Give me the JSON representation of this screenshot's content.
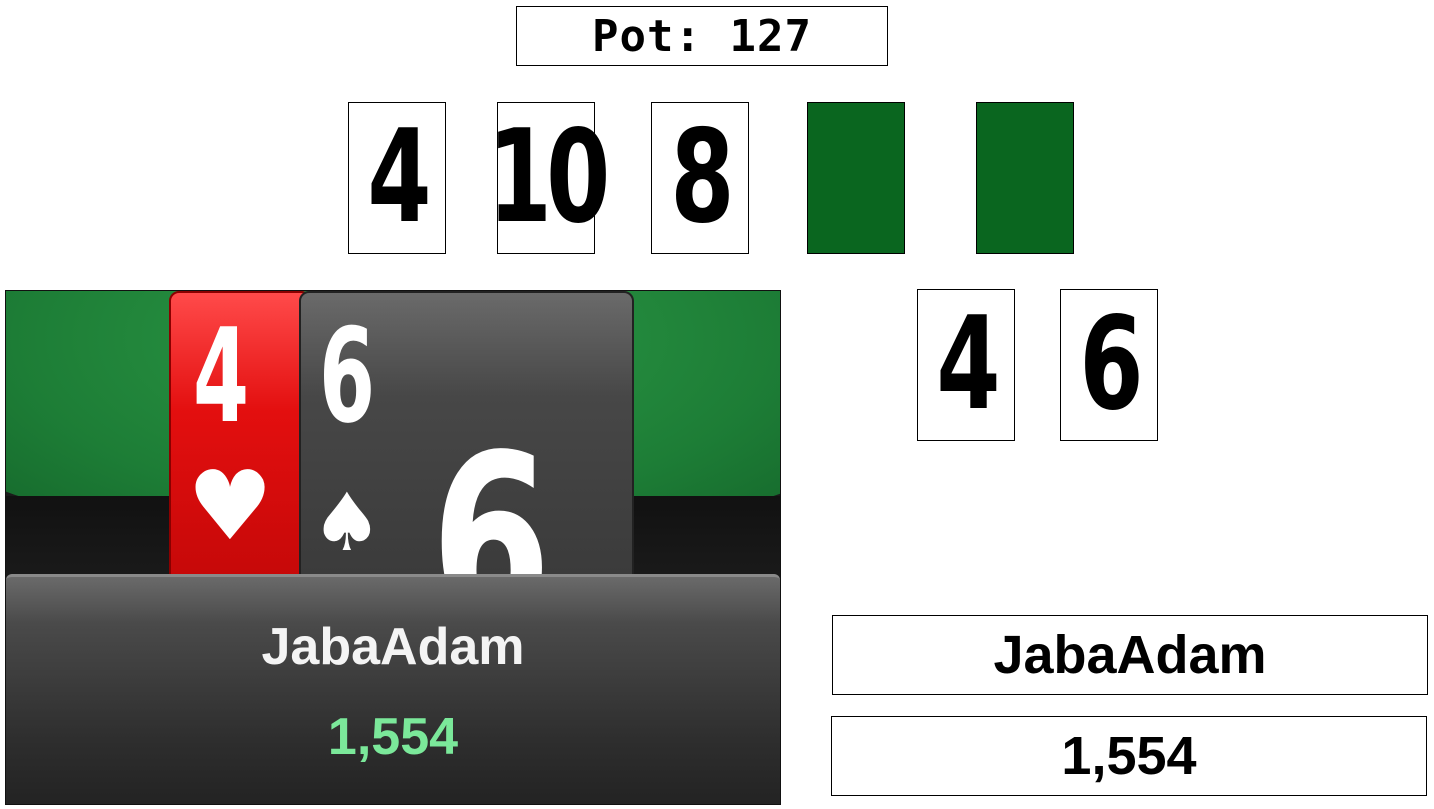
{
  "pot": {
    "label": "Pot: 127"
  },
  "board": {
    "cards": [
      {
        "rank": "4",
        "face_up": true
      },
      {
        "rank": "10",
        "face_up": true
      },
      {
        "rank": "8",
        "face_up": true
      },
      {
        "rank": "",
        "face_up": false
      },
      {
        "rank": "",
        "face_up": false
      }
    ],
    "facedown_color": "#0a661f"
  },
  "hole_cards": [
    {
      "rank": "4"
    },
    {
      "rank": "6"
    }
  ],
  "client_view": {
    "cards": [
      {
        "rank": "4",
        "suit": "♥",
        "suit_name": "hearts",
        "color": "#e30f0f"
      },
      {
        "rank": "6",
        "suit": "♠",
        "suit_name": "spades",
        "color": "#474747"
      }
    ],
    "player_name": "JabaAdam",
    "player_stack": "1,554",
    "stack_color": "#7be89a",
    "felt_color": "#1d7d36"
  },
  "player": {
    "name": "JabaAdam",
    "stack": "1,554"
  }
}
